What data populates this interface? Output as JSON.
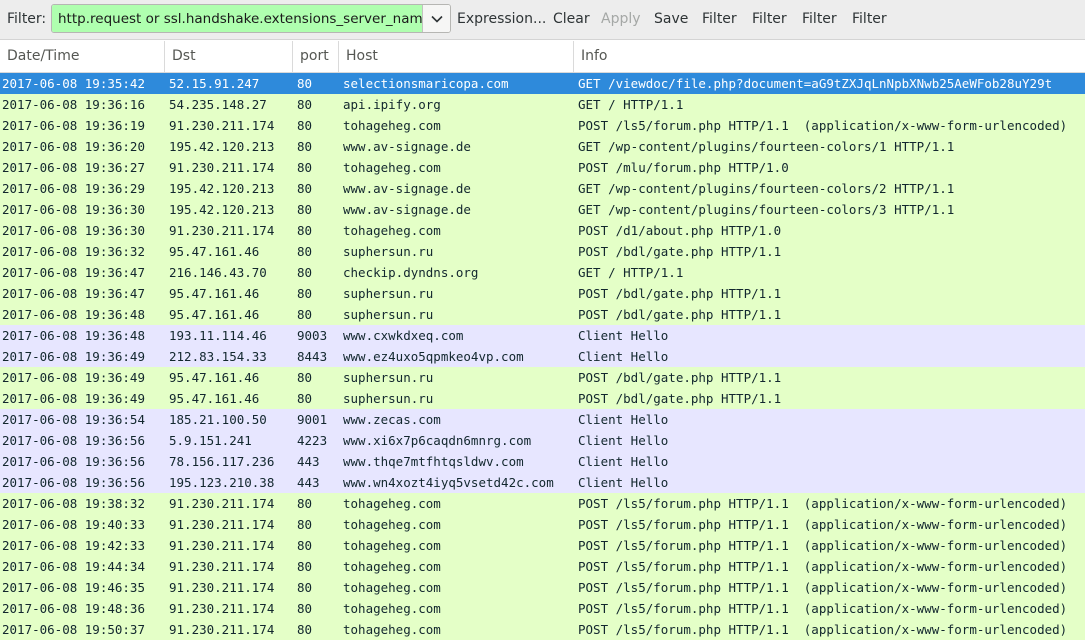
{
  "toolbar": {
    "filter_label": "Filter:",
    "filter_value": "http.request or ssl.handshake.extensions_server_name",
    "expression_label": "Expression...",
    "clear_label": "Clear",
    "apply_label": "Apply",
    "save_label": "Save",
    "extra_buttons": [
      "Filter",
      "Filter",
      "Filter",
      "Filter"
    ],
    "filter_color": "#afffaf"
  },
  "columns": [
    "Date/Time",
    "Dst",
    "port",
    "Host",
    "Info"
  ],
  "colors": {
    "http_row": "#e4ffc7",
    "tls_row": "#e7e6ff",
    "selected_row": "#2e8adb"
  },
  "rows": [
    {
      "datetime": "2017-06-08 19:35:42",
      "dst": "52.15.91.247",
      "port": "80",
      "host": "selectionsmaricopa.com",
      "info": "GET /viewdoc/file.php?document=aG9tZXJqLnNpbXNwb25AeWFob28uY29t",
      "kind": "http",
      "selected": true
    },
    {
      "datetime": "2017-06-08 19:36:16",
      "dst": "54.235.148.27",
      "port": "80",
      "host": "api.ipify.org",
      "info": "GET / HTTP/1.1",
      "kind": "http"
    },
    {
      "datetime": "2017-06-08 19:36:19",
      "dst": "91.230.211.174",
      "port": "80",
      "host": "tohageheg.com",
      "info": "POST /ls5/forum.php HTTP/1.1  (application/x-www-form-urlencoded)",
      "kind": "http"
    },
    {
      "datetime": "2017-06-08 19:36:20",
      "dst": "195.42.120.213",
      "port": "80",
      "host": "www.av-signage.de",
      "info": "GET /wp-content/plugins/fourteen-colors/1 HTTP/1.1",
      "kind": "http"
    },
    {
      "datetime": "2017-06-08 19:36:27",
      "dst": "91.230.211.174",
      "port": "80",
      "host": "tohageheg.com",
      "info": "POST /mlu/forum.php HTTP/1.0",
      "kind": "http"
    },
    {
      "datetime": "2017-06-08 19:36:29",
      "dst": "195.42.120.213",
      "port": "80",
      "host": "www.av-signage.de",
      "info": "GET /wp-content/plugins/fourteen-colors/2 HTTP/1.1",
      "kind": "http"
    },
    {
      "datetime": "2017-06-08 19:36:30",
      "dst": "195.42.120.213",
      "port": "80",
      "host": "www.av-signage.de",
      "info": "GET /wp-content/plugins/fourteen-colors/3 HTTP/1.1",
      "kind": "http"
    },
    {
      "datetime": "2017-06-08 19:36:30",
      "dst": "91.230.211.174",
      "port": "80",
      "host": "tohageheg.com",
      "info": "POST /d1/about.php HTTP/1.0",
      "kind": "http"
    },
    {
      "datetime": "2017-06-08 19:36:32",
      "dst": "95.47.161.46",
      "port": "80",
      "host": "suphersun.ru",
      "info": "POST /bdl/gate.php HTTP/1.1",
      "kind": "http"
    },
    {
      "datetime": "2017-06-08 19:36:47",
      "dst": "216.146.43.70",
      "port": "80",
      "host": "checkip.dyndns.org",
      "info": "GET / HTTP/1.1",
      "kind": "http"
    },
    {
      "datetime": "2017-06-08 19:36:47",
      "dst": "95.47.161.46",
      "port": "80",
      "host": "suphersun.ru",
      "info": "POST /bdl/gate.php HTTP/1.1",
      "kind": "http"
    },
    {
      "datetime": "2017-06-08 19:36:48",
      "dst": "95.47.161.46",
      "port": "80",
      "host": "suphersun.ru",
      "info": "POST /bdl/gate.php HTTP/1.1",
      "kind": "http"
    },
    {
      "datetime": "2017-06-08 19:36:48",
      "dst": "193.11.114.46",
      "port": "9003",
      "host": "www.cxwkdxeq.com",
      "info": "Client Hello",
      "kind": "tls"
    },
    {
      "datetime": "2017-06-08 19:36:49",
      "dst": "212.83.154.33",
      "port": "8443",
      "host": "www.ez4uxo5qpmkeo4vp.com",
      "info": "Client Hello",
      "kind": "tls"
    },
    {
      "datetime": "2017-06-08 19:36:49",
      "dst": "95.47.161.46",
      "port": "80",
      "host": "suphersun.ru",
      "info": "POST /bdl/gate.php HTTP/1.1",
      "kind": "http"
    },
    {
      "datetime": "2017-06-08 19:36:49",
      "dst": "95.47.161.46",
      "port": "80",
      "host": "suphersun.ru",
      "info": "POST /bdl/gate.php HTTP/1.1",
      "kind": "http"
    },
    {
      "datetime": "2017-06-08 19:36:54",
      "dst": "185.21.100.50",
      "port": "9001",
      "host": "www.zecas.com",
      "info": "Client Hello",
      "kind": "tls"
    },
    {
      "datetime": "2017-06-08 19:36:56",
      "dst": "5.9.151.241",
      "port": "4223",
      "host": "www.xi6x7p6caqdn6mnrg.com",
      "info": "Client Hello",
      "kind": "tls"
    },
    {
      "datetime": "2017-06-08 19:36:56",
      "dst": "78.156.117.236",
      "port": "443",
      "host": "www.thqe7mtfhtqsldwv.com",
      "info": "Client Hello",
      "kind": "tls"
    },
    {
      "datetime": "2017-06-08 19:36:56",
      "dst": "195.123.210.38",
      "port": "443",
      "host": "www.wn4xozt4iyq5vsetd42c.com",
      "info": "Client Hello",
      "kind": "tls"
    },
    {
      "datetime": "2017-06-08 19:38:32",
      "dst": "91.230.211.174",
      "port": "80",
      "host": "tohageheg.com",
      "info": "POST /ls5/forum.php HTTP/1.1  (application/x-www-form-urlencoded)",
      "kind": "http"
    },
    {
      "datetime": "2017-06-08 19:40:33",
      "dst": "91.230.211.174",
      "port": "80",
      "host": "tohageheg.com",
      "info": "POST /ls5/forum.php HTTP/1.1  (application/x-www-form-urlencoded)",
      "kind": "http"
    },
    {
      "datetime": "2017-06-08 19:42:33",
      "dst": "91.230.211.174",
      "port": "80",
      "host": "tohageheg.com",
      "info": "POST /ls5/forum.php HTTP/1.1  (application/x-www-form-urlencoded)",
      "kind": "http"
    },
    {
      "datetime": "2017-06-08 19:44:34",
      "dst": "91.230.211.174",
      "port": "80",
      "host": "tohageheg.com",
      "info": "POST /ls5/forum.php HTTP/1.1  (application/x-www-form-urlencoded)",
      "kind": "http"
    },
    {
      "datetime": "2017-06-08 19:46:35",
      "dst": "91.230.211.174",
      "port": "80",
      "host": "tohageheg.com",
      "info": "POST /ls5/forum.php HTTP/1.1  (application/x-www-form-urlencoded)",
      "kind": "http"
    },
    {
      "datetime": "2017-06-08 19:48:36",
      "dst": "91.230.211.174",
      "port": "80",
      "host": "tohageheg.com",
      "info": "POST /ls5/forum.php HTTP/1.1  (application/x-www-form-urlencoded)",
      "kind": "http"
    },
    {
      "datetime": "2017-06-08 19:50:37",
      "dst": "91.230.211.174",
      "port": "80",
      "host": "tohageheg.com",
      "info": "POST /ls5/forum.php HTTP/1.1  (application/x-www-form-urlencoded)",
      "kind": "http"
    }
  ]
}
